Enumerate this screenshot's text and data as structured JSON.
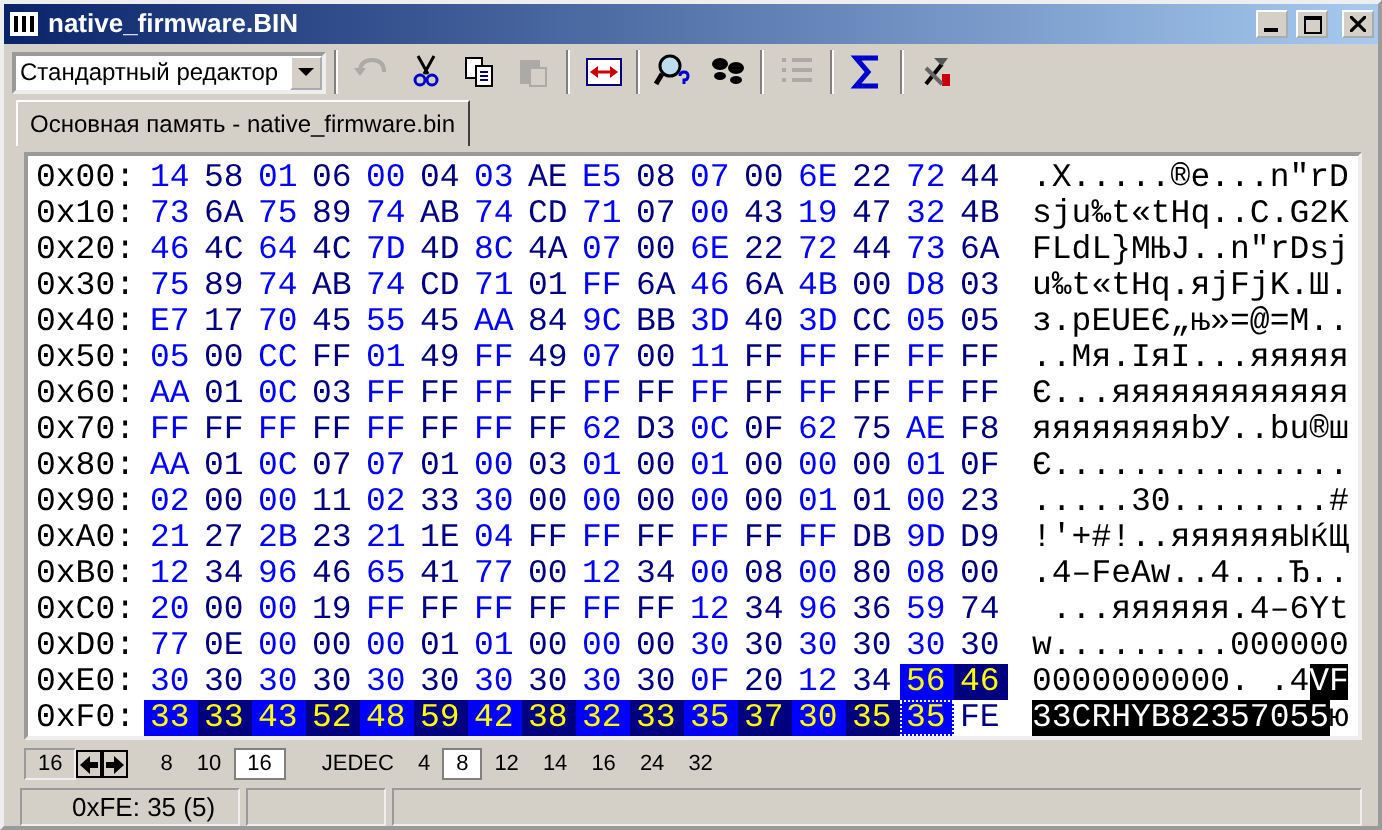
{
  "window": {
    "title": "native_firmware.BIN"
  },
  "toolbar": {
    "editor_select": "Стандартный редактор",
    "tools": [
      {
        "kind": "undo",
        "disabled": true
      },
      {
        "kind": "cut",
        "disabled": false
      },
      {
        "kind": "copy",
        "disabled": false
      },
      {
        "kind": "paste",
        "disabled": true
      },
      {
        "kind": "swap",
        "disabled": false
      },
      {
        "kind": "find",
        "disabled": false
      },
      {
        "kind": "steps",
        "disabled": false
      },
      {
        "kind": "list",
        "disabled": true
      },
      {
        "kind": "sum",
        "disabled": false
      },
      {
        "kind": "tools",
        "disabled": false
      }
    ]
  },
  "tabs": [
    {
      "label": "Основная память - native_firmware.bin",
      "selected": true
    }
  ],
  "hex_view": {
    "rows": [
      {
        "offset": "0x00:",
        "bytes": [
          {
            "text": "14",
            "selected": false
          },
          {
            "text": "58",
            "selected": false
          },
          {
            "text": "01",
            "selected": false
          },
          {
            "text": "06",
            "selected": false
          },
          {
            "text": "00",
            "selected": false
          },
          {
            "text": "04",
            "selected": false
          },
          {
            "text": "03",
            "selected": false
          },
          {
            "text": "AE",
            "selected": false
          },
          {
            "text": "E5",
            "selected": false
          },
          {
            "text": "08",
            "selected": false
          },
          {
            "text": "07",
            "selected": false
          },
          {
            "text": "00",
            "selected": false
          },
          {
            "text": "6E",
            "selected": false
          },
          {
            "text": "22",
            "selected": false
          },
          {
            "text": "72",
            "selected": false
          },
          {
            "text": "44",
            "selected": false
          }
        ],
        "ascii": [
          {
            "text": ".X.....®е...n\"rD",
            "selected": false
          }
        ]
      },
      {
        "offset": "0x10:",
        "bytes": [
          {
            "text": "73",
            "selected": false
          },
          {
            "text": "6A",
            "selected": false
          },
          {
            "text": "75",
            "selected": false
          },
          {
            "text": "89",
            "selected": false
          },
          {
            "text": "74",
            "selected": false
          },
          {
            "text": "AB",
            "selected": false
          },
          {
            "text": "74",
            "selected": false
          },
          {
            "text": "CD",
            "selected": false
          },
          {
            "text": "71",
            "selected": false
          },
          {
            "text": "07",
            "selected": false
          },
          {
            "text": "00",
            "selected": false
          },
          {
            "text": "43",
            "selected": false
          },
          {
            "text": "19",
            "selected": false
          },
          {
            "text": "47",
            "selected": false
          },
          {
            "text": "32",
            "selected": false
          },
          {
            "text": "4B",
            "selected": false
          }
        ],
        "ascii": [
          {
            "text": "sju‰t«tНq..C.G2K",
            "selected": false
          }
        ]
      },
      {
        "offset": "0x20:",
        "bytes": [
          {
            "text": "46",
            "selected": false
          },
          {
            "text": "4C",
            "selected": false
          },
          {
            "text": "64",
            "selected": false
          },
          {
            "text": "4C",
            "selected": false
          },
          {
            "text": "7D",
            "selected": false
          },
          {
            "text": "4D",
            "selected": false
          },
          {
            "text": "8C",
            "selected": false
          },
          {
            "text": "4A",
            "selected": false
          },
          {
            "text": "07",
            "selected": false
          },
          {
            "text": "00",
            "selected": false
          },
          {
            "text": "6E",
            "selected": false
          },
          {
            "text": "22",
            "selected": false
          },
          {
            "text": "72",
            "selected": false
          },
          {
            "text": "44",
            "selected": false
          },
          {
            "text": "73",
            "selected": false
          },
          {
            "text": "6A",
            "selected": false
          }
        ],
        "ascii": [
          {
            "text": "FLdL}MЊJ..n\"rDsj",
            "selected": false
          }
        ]
      },
      {
        "offset": "0x30:",
        "bytes": [
          {
            "text": "75",
            "selected": false
          },
          {
            "text": "89",
            "selected": false
          },
          {
            "text": "74",
            "selected": false
          },
          {
            "text": "AB",
            "selected": false
          },
          {
            "text": "74",
            "selected": false
          },
          {
            "text": "CD",
            "selected": false
          },
          {
            "text": "71",
            "selected": false
          },
          {
            "text": "01",
            "selected": false
          },
          {
            "text": "FF",
            "selected": false
          },
          {
            "text": "6A",
            "selected": false
          },
          {
            "text": "46",
            "selected": false
          },
          {
            "text": "6A",
            "selected": false
          },
          {
            "text": "4B",
            "selected": false
          },
          {
            "text": "00",
            "selected": false
          },
          {
            "text": "D8",
            "selected": false
          },
          {
            "text": "03",
            "selected": false
          }
        ],
        "ascii": [
          {
            "text": "u‰t«tНq.яjFjK.Ш.",
            "selected": false
          }
        ]
      },
      {
        "offset": "0x40:",
        "bytes": [
          {
            "text": "E7",
            "selected": false
          },
          {
            "text": "17",
            "selected": false
          },
          {
            "text": "70",
            "selected": false
          },
          {
            "text": "45",
            "selected": false
          },
          {
            "text": "55",
            "selected": false
          },
          {
            "text": "45",
            "selected": false
          },
          {
            "text": "AA",
            "selected": false
          },
          {
            "text": "84",
            "selected": false
          },
          {
            "text": "9C",
            "selected": false
          },
          {
            "text": "BB",
            "selected": false
          },
          {
            "text": "3D",
            "selected": false
          },
          {
            "text": "40",
            "selected": false
          },
          {
            "text": "3D",
            "selected": false
          },
          {
            "text": "CC",
            "selected": false
          },
          {
            "text": "05",
            "selected": false
          },
          {
            "text": "05",
            "selected": false
          }
        ],
        "ascii": [
          {
            "text": "з.pEUEЄ„њ»=@=М..",
            "selected": false
          }
        ]
      },
      {
        "offset": "0x50:",
        "bytes": [
          {
            "text": "05",
            "selected": false
          },
          {
            "text": "00",
            "selected": false
          },
          {
            "text": "CC",
            "selected": false
          },
          {
            "text": "FF",
            "selected": false
          },
          {
            "text": "01",
            "selected": false
          },
          {
            "text": "49",
            "selected": false
          },
          {
            "text": "FF",
            "selected": false
          },
          {
            "text": "49",
            "selected": false
          },
          {
            "text": "07",
            "selected": false
          },
          {
            "text": "00",
            "selected": false
          },
          {
            "text": "11",
            "selected": false
          },
          {
            "text": "FF",
            "selected": false
          },
          {
            "text": "FF",
            "selected": false
          },
          {
            "text": "FF",
            "selected": false
          },
          {
            "text": "FF",
            "selected": false
          },
          {
            "text": "FF",
            "selected": false
          }
        ],
        "ascii": [
          {
            "text": "..Мя.IяI...яяяяя",
            "selected": false
          }
        ]
      },
      {
        "offset": "0x60:",
        "bytes": [
          {
            "text": "AA",
            "selected": false
          },
          {
            "text": "01",
            "selected": false
          },
          {
            "text": "0C",
            "selected": false
          },
          {
            "text": "03",
            "selected": false
          },
          {
            "text": "FF",
            "selected": false
          },
          {
            "text": "FF",
            "selected": false
          },
          {
            "text": "FF",
            "selected": false
          },
          {
            "text": "FF",
            "selected": false
          },
          {
            "text": "FF",
            "selected": false
          },
          {
            "text": "FF",
            "selected": false
          },
          {
            "text": "FF",
            "selected": false
          },
          {
            "text": "FF",
            "selected": false
          },
          {
            "text": "FF",
            "selected": false
          },
          {
            "text": "FF",
            "selected": false
          },
          {
            "text": "FF",
            "selected": false
          },
          {
            "text": "FF",
            "selected": false
          }
        ],
        "ascii": [
          {
            "text": "Є...яяяяяяяяяяяя",
            "selected": false
          }
        ]
      },
      {
        "offset": "0x70:",
        "bytes": [
          {
            "text": "FF",
            "selected": false
          },
          {
            "text": "FF",
            "selected": false
          },
          {
            "text": "FF",
            "selected": false
          },
          {
            "text": "FF",
            "selected": false
          },
          {
            "text": "FF",
            "selected": false
          },
          {
            "text": "FF",
            "selected": false
          },
          {
            "text": "FF",
            "selected": false
          },
          {
            "text": "FF",
            "selected": false
          },
          {
            "text": "62",
            "selected": false
          },
          {
            "text": "D3",
            "selected": false
          },
          {
            "text": "0C",
            "selected": false
          },
          {
            "text": "0F",
            "selected": false
          },
          {
            "text": "62",
            "selected": false
          },
          {
            "text": "75",
            "selected": false
          },
          {
            "text": "AE",
            "selected": false
          },
          {
            "text": "F8",
            "selected": false
          }
        ],
        "ascii": [
          {
            "text": "яяяяяяяяbУ..bu®ш",
            "selected": false
          }
        ]
      },
      {
        "offset": "0x80:",
        "bytes": [
          {
            "text": "AA",
            "selected": false
          },
          {
            "text": "01",
            "selected": false
          },
          {
            "text": "0C",
            "selected": false
          },
          {
            "text": "07",
            "selected": false
          },
          {
            "text": "07",
            "selected": false
          },
          {
            "text": "01",
            "selected": false
          },
          {
            "text": "00",
            "selected": false
          },
          {
            "text": "03",
            "selected": false
          },
          {
            "text": "01",
            "selected": false
          },
          {
            "text": "00",
            "selected": false
          },
          {
            "text": "01",
            "selected": false
          },
          {
            "text": "00",
            "selected": false
          },
          {
            "text": "00",
            "selected": false
          },
          {
            "text": "00",
            "selected": false
          },
          {
            "text": "01",
            "selected": false
          },
          {
            "text": "0F",
            "selected": false
          }
        ],
        "ascii": [
          {
            "text": "Є...............",
            "selected": false
          }
        ]
      },
      {
        "offset": "0x90:",
        "bytes": [
          {
            "text": "02",
            "selected": false
          },
          {
            "text": "00",
            "selected": false
          },
          {
            "text": "00",
            "selected": false
          },
          {
            "text": "11",
            "selected": false
          },
          {
            "text": "02",
            "selected": false
          },
          {
            "text": "33",
            "selected": false
          },
          {
            "text": "30",
            "selected": false
          },
          {
            "text": "00",
            "selected": false
          },
          {
            "text": "00",
            "selected": false
          },
          {
            "text": "00",
            "selected": false
          },
          {
            "text": "00",
            "selected": false
          },
          {
            "text": "00",
            "selected": false
          },
          {
            "text": "01",
            "selected": false
          },
          {
            "text": "01",
            "selected": false
          },
          {
            "text": "00",
            "selected": false
          },
          {
            "text": "23",
            "selected": false
          }
        ],
        "ascii": [
          {
            "text": ".....30........#",
            "selected": false
          }
        ]
      },
      {
        "offset": "0xA0:",
        "bytes": [
          {
            "text": "21",
            "selected": false
          },
          {
            "text": "27",
            "selected": false
          },
          {
            "text": "2B",
            "selected": false
          },
          {
            "text": "23",
            "selected": false
          },
          {
            "text": "21",
            "selected": false
          },
          {
            "text": "1E",
            "selected": false
          },
          {
            "text": "04",
            "selected": false
          },
          {
            "text": "FF",
            "selected": false
          },
          {
            "text": "FF",
            "selected": false
          },
          {
            "text": "FF",
            "selected": false
          },
          {
            "text": "FF",
            "selected": false
          },
          {
            "text": "FF",
            "selected": false
          },
          {
            "text": "FF",
            "selected": false
          },
          {
            "text": "DB",
            "selected": false
          },
          {
            "text": "9D",
            "selected": false
          },
          {
            "text": "D9",
            "selected": false
          }
        ],
        "ascii": [
          {
            "text": "!'+#!..яяяяяяЫќЩ",
            "selected": false
          }
        ]
      },
      {
        "offset": "0xB0:",
        "bytes": [
          {
            "text": "12",
            "selected": false
          },
          {
            "text": "34",
            "selected": false
          },
          {
            "text": "96",
            "selected": false
          },
          {
            "text": "46",
            "selected": false
          },
          {
            "text": "65",
            "selected": false
          },
          {
            "text": "41",
            "selected": false
          },
          {
            "text": "77",
            "selected": false
          },
          {
            "text": "00",
            "selected": false
          },
          {
            "text": "12",
            "selected": false
          },
          {
            "text": "34",
            "selected": false
          },
          {
            "text": "00",
            "selected": false
          },
          {
            "text": "08",
            "selected": false
          },
          {
            "text": "00",
            "selected": false
          },
          {
            "text": "80",
            "selected": false
          },
          {
            "text": "08",
            "selected": false
          },
          {
            "text": "00",
            "selected": false
          }
        ],
        "ascii": [
          {
            "text": ".4–FeAw..4...Ђ..",
            "selected": false
          }
        ]
      },
      {
        "offset": "0xC0:",
        "bytes": [
          {
            "text": "20",
            "selected": false
          },
          {
            "text": "00",
            "selected": false
          },
          {
            "text": "00",
            "selected": false
          },
          {
            "text": "19",
            "selected": false
          },
          {
            "text": "FF",
            "selected": false
          },
          {
            "text": "FF",
            "selected": false
          },
          {
            "text": "FF",
            "selected": false
          },
          {
            "text": "FF",
            "selected": false
          },
          {
            "text": "FF",
            "selected": false
          },
          {
            "text": "FF",
            "selected": false
          },
          {
            "text": "12",
            "selected": false
          },
          {
            "text": "34",
            "selected": false
          },
          {
            "text": "96",
            "selected": false
          },
          {
            "text": "36",
            "selected": false
          },
          {
            "text": "59",
            "selected": false
          },
          {
            "text": "74",
            "selected": false
          }
        ],
        "ascii": [
          {
            "text": " ...яяяяяя.4–6Yt",
            "selected": false
          }
        ]
      },
      {
        "offset": "0xD0:",
        "bytes": [
          {
            "text": "77",
            "selected": false
          },
          {
            "text": "0E",
            "selected": false
          },
          {
            "text": "00",
            "selected": false
          },
          {
            "text": "00",
            "selected": false
          },
          {
            "text": "00",
            "selected": false
          },
          {
            "text": "01",
            "selected": false
          },
          {
            "text": "01",
            "selected": false
          },
          {
            "text": "00",
            "selected": false
          },
          {
            "text": "00",
            "selected": false
          },
          {
            "text": "00",
            "selected": false
          },
          {
            "text": "30",
            "selected": false
          },
          {
            "text": "30",
            "selected": false
          },
          {
            "text": "30",
            "selected": false
          },
          {
            "text": "30",
            "selected": false
          },
          {
            "text": "30",
            "selected": false
          },
          {
            "text": "30",
            "selected": false
          }
        ],
        "ascii": [
          {
            "text": "w.........000000",
            "selected": false
          }
        ]
      },
      {
        "offset": "0xE0:",
        "bytes": [
          {
            "text": "30",
            "selected": false
          },
          {
            "text": "30",
            "selected": false
          },
          {
            "text": "30",
            "selected": false
          },
          {
            "text": "30",
            "selected": false
          },
          {
            "text": "30",
            "selected": false
          },
          {
            "text": "30",
            "selected": false
          },
          {
            "text": "30",
            "selected": false
          },
          {
            "text": "30",
            "selected": false
          },
          {
            "text": "30",
            "selected": false
          },
          {
            "text": "30",
            "selected": false
          },
          {
            "text": "0F",
            "selected": false
          },
          {
            "text": "20",
            "selected": false
          },
          {
            "text": "12",
            "selected": false
          },
          {
            "text": "34",
            "selected": false
          },
          {
            "text": "56",
            "selected": true
          },
          {
            "text": "46",
            "selected": true
          }
        ],
        "ascii": [
          {
            "text": "0000000000. .4",
            "selected": false
          },
          {
            "text": "VF",
            "selected": true
          }
        ]
      },
      {
        "offset": "0xF0:",
        "bytes": [
          {
            "text": "33",
            "selected": true
          },
          {
            "text": "33",
            "selected": true
          },
          {
            "text": "43",
            "selected": true
          },
          {
            "text": "52",
            "selected": true
          },
          {
            "text": "48",
            "selected": true
          },
          {
            "text": "59",
            "selected": true
          },
          {
            "text": "42",
            "selected": true
          },
          {
            "text": "38",
            "selected": true
          },
          {
            "text": "32",
            "selected": true
          },
          {
            "text": "33",
            "selected": true
          },
          {
            "text": "35",
            "selected": true
          },
          {
            "text": "37",
            "selected": true
          },
          {
            "text": "30",
            "selected": true
          },
          {
            "text": "35",
            "selected": true
          },
          {
            "text": "35",
            "selected": true,
            "cursor": true
          },
          {
            "text": "FE",
            "selected": false
          }
        ],
        "ascii": [
          {
            "text": "33CRHYB82357055",
            "selected": true
          },
          {
            "text": "ю",
            "selected": false
          }
        ]
      }
    ]
  },
  "format_bar": {
    "items": [
      {
        "kind": "field",
        "text": "16"
      },
      {
        "kind": "arrows"
      },
      {
        "kind": "option",
        "text": "8",
        "selected": false
      },
      {
        "kind": "option",
        "text": "10",
        "selected": false
      },
      {
        "kind": "option",
        "text": "16",
        "selected": true
      },
      {
        "kind": "label",
        "text": "JEDEC"
      },
      {
        "kind": "option",
        "text": "4",
        "selected": false
      },
      {
        "kind": "option",
        "text": "8",
        "selected": true
      },
      {
        "kind": "option",
        "text": "12",
        "selected": false
      },
      {
        "kind": "option",
        "text": "14",
        "selected": false
      },
      {
        "kind": "option",
        "text": "16",
        "selected": false
      },
      {
        "kind": "option",
        "text": "24",
        "selected": false
      },
      {
        "kind": "option",
        "text": "32",
        "selected": false
      }
    ]
  },
  "status_bar": {
    "position": "0xFE: 35 (5)"
  }
}
